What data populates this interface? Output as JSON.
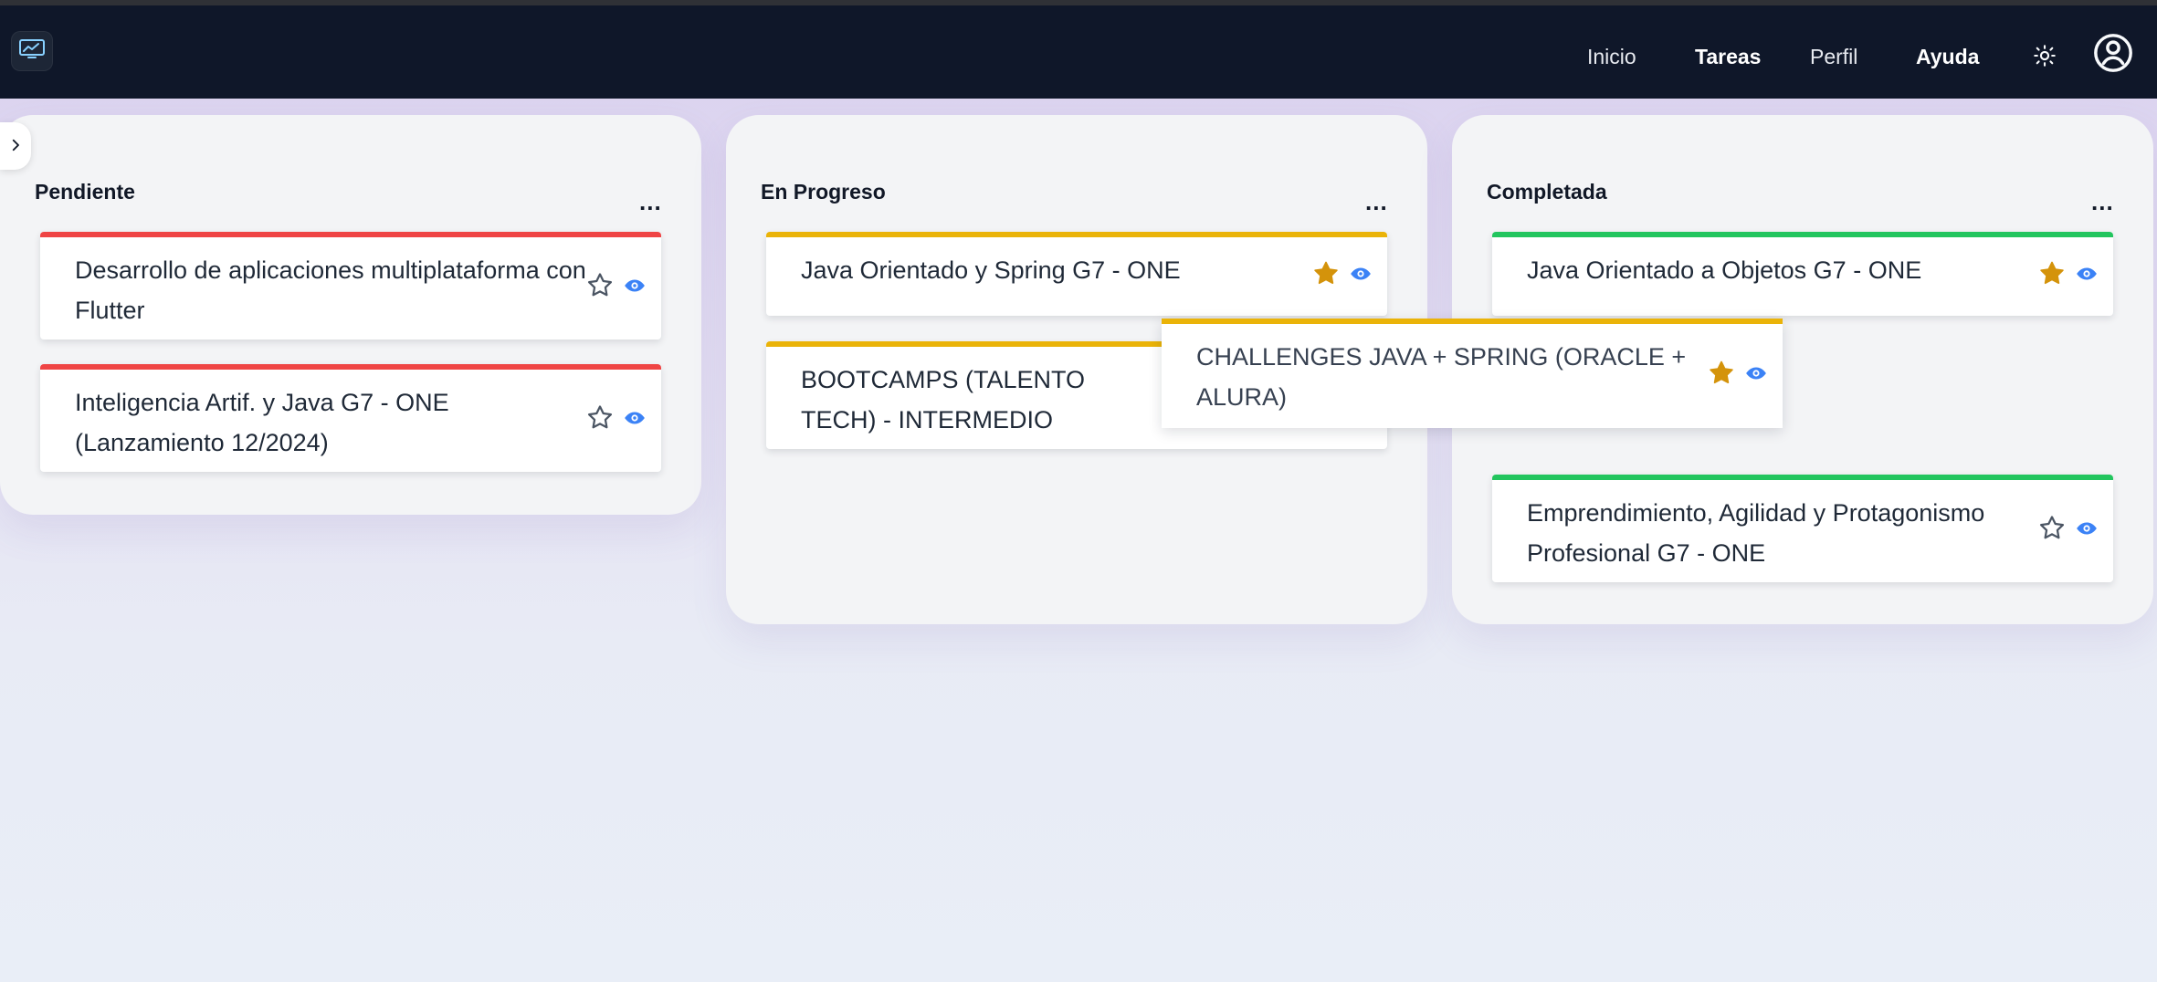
{
  "nav": {
    "logo_icon": "chart-monitor-icon",
    "links": [
      {
        "label": "Inicio"
      },
      {
        "label": "Tareas"
      },
      {
        "label": "Perfil"
      },
      {
        "label": "Ayuda"
      }
    ],
    "settings_icon": "gear-icon",
    "profile_icon": "user-circle-icon"
  },
  "sidebar": {
    "toggle_icon": "chevron-right-icon"
  },
  "board": {
    "columns": [
      {
        "title": "Pendiente",
        "menu_label": "...",
        "cards": [
          {
            "title": "Desarrollo de aplicaciones multiplataforma con Flutter",
            "favorite": false,
            "accent": "#ef4444"
          },
          {
            "title": "Inteligencia Artif. y Java G7 - ONE (Lanzamiento 12/2024)",
            "favorite": false,
            "accent": "#ef4444"
          }
        ]
      },
      {
        "title": "En Progreso",
        "menu_label": "...",
        "cards": [
          {
            "title": "Java Orientado y Spring G7 - ONE",
            "favorite": true,
            "accent": "#eab308"
          },
          {
            "title": "BOOTCAMPS (TALENTO TECH) - INTERMEDIO",
            "favorite": false,
            "accent": "#eab308"
          }
        ]
      },
      {
        "title": "Completada",
        "menu_label": "...",
        "cards": [
          {
            "title": "Java Orientado a Objetos G7 - ONE",
            "favorite": true,
            "accent": "#22c55e"
          },
          {
            "title": "Emprendimiento, Agilidad y Protagonismo Profesional G7 - ONE",
            "favorite": false,
            "accent": "#22c55e"
          }
        ]
      }
    ],
    "drag_card": {
      "title": "CHALLENGES JAVA + SPRING (ORACLE + ALURA)",
      "favorite": true,
      "accent": "#eab308"
    }
  },
  "colors": {
    "navbar": "#0f1729",
    "star_filled": "#d4930b",
    "star_outline": "#4b5563",
    "eye": "#3b82f6"
  }
}
